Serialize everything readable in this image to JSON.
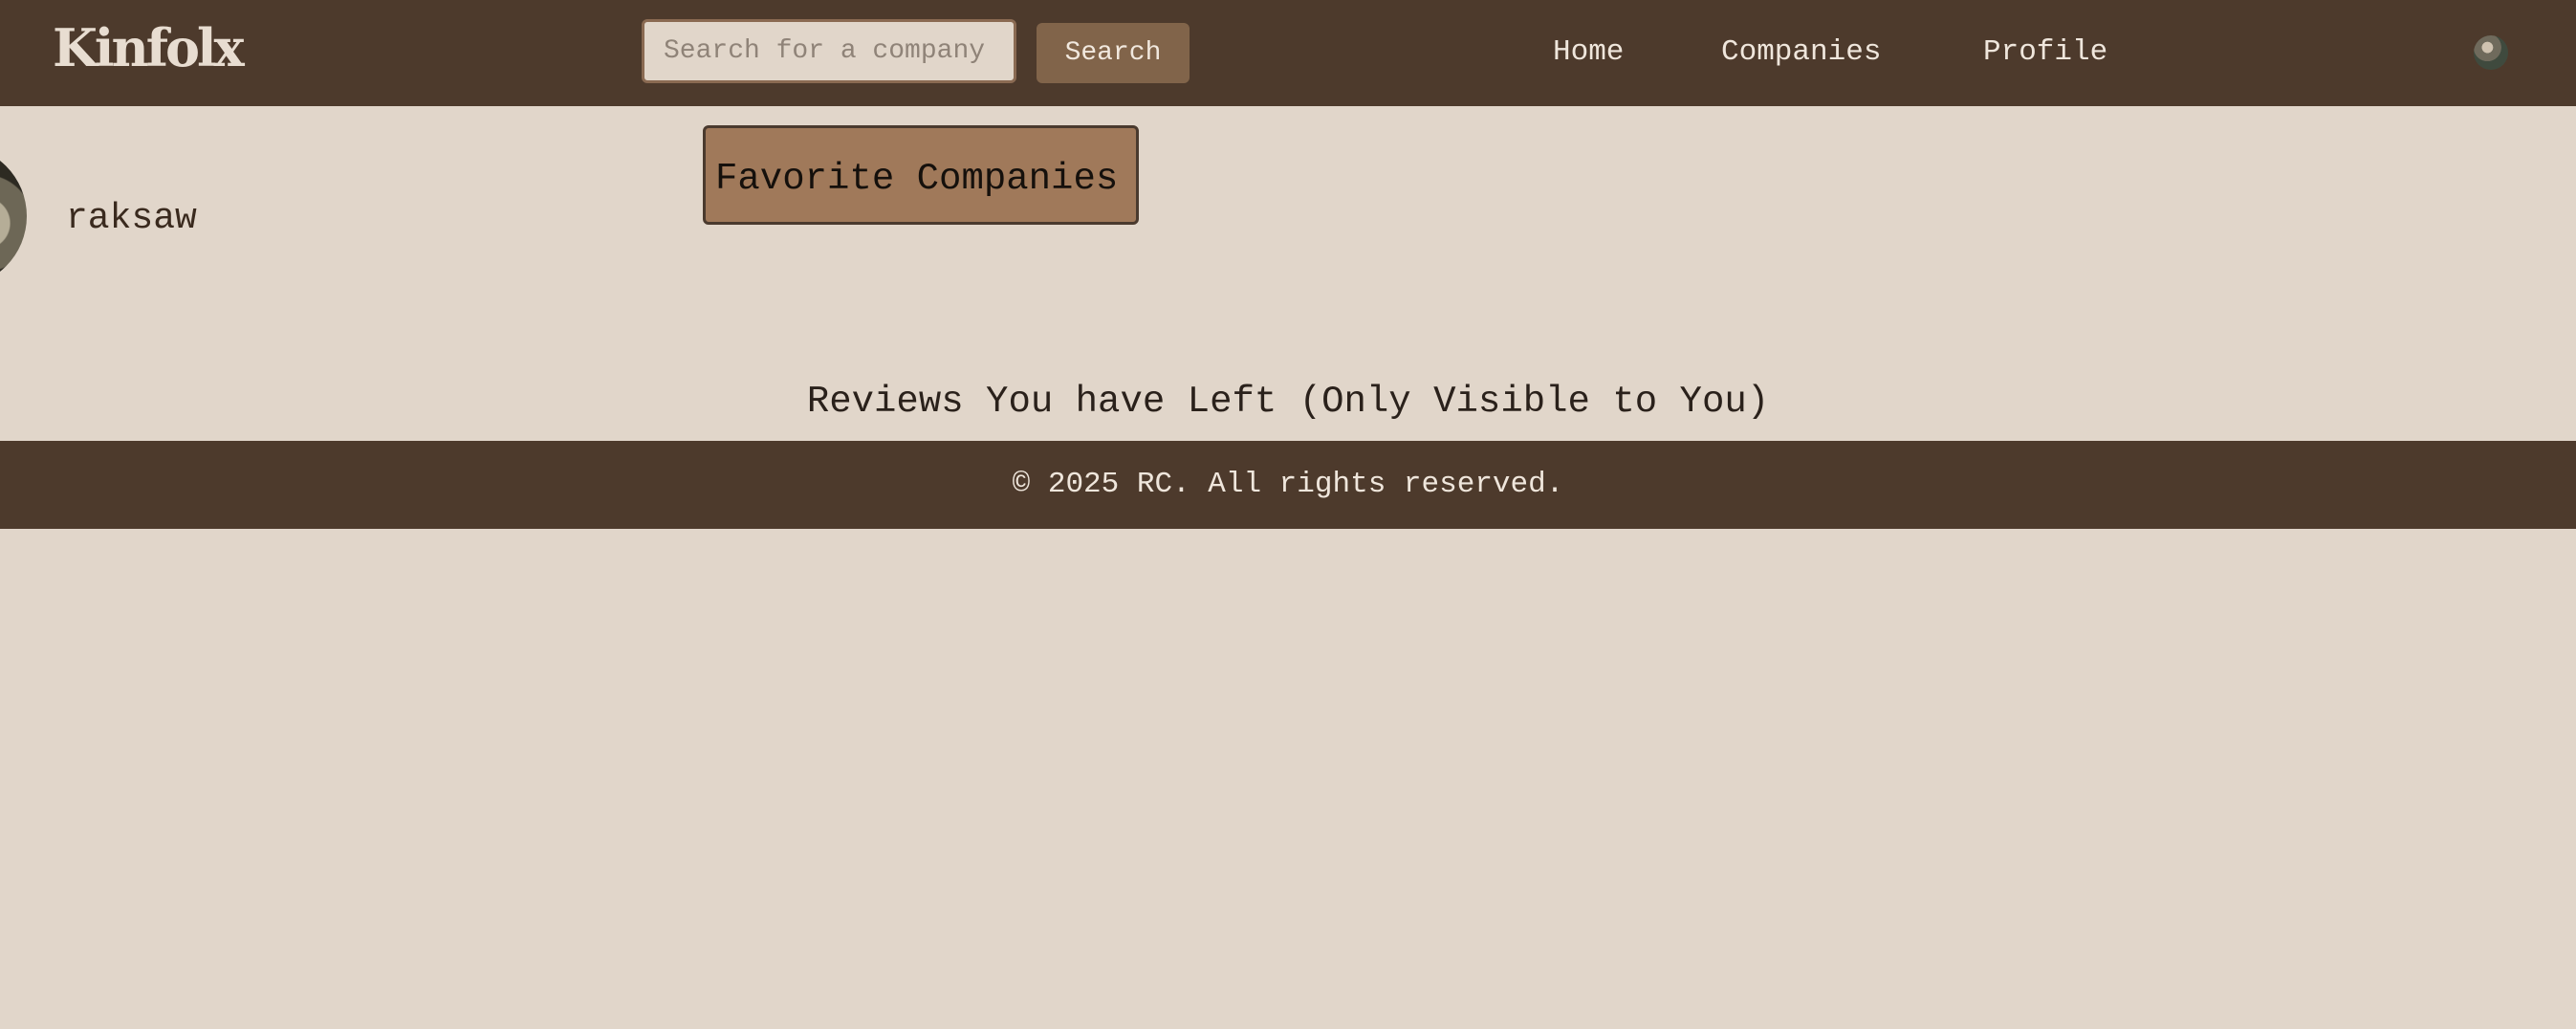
{
  "header": {
    "logo_text": "Kinfolx",
    "search": {
      "placeholder": "Search for a company",
      "value": ""
    },
    "search_button_label": "Search",
    "nav": {
      "home": "Home",
      "companies": "Companies",
      "profile": "Profile"
    }
  },
  "profile": {
    "username": "raksaw",
    "favorite_companies_label": "Favorite Companies",
    "reviews_heading": "Reviews You have Left (Only Visible to You)"
  },
  "footer": {
    "copyright": "© 2025 RC. All rights reserved."
  },
  "colors": {
    "header_bg": "#4d3a2c",
    "page_bg": "#e1d6ca",
    "button_bg": "#81644a",
    "favorite_bg": "#a0795a"
  }
}
